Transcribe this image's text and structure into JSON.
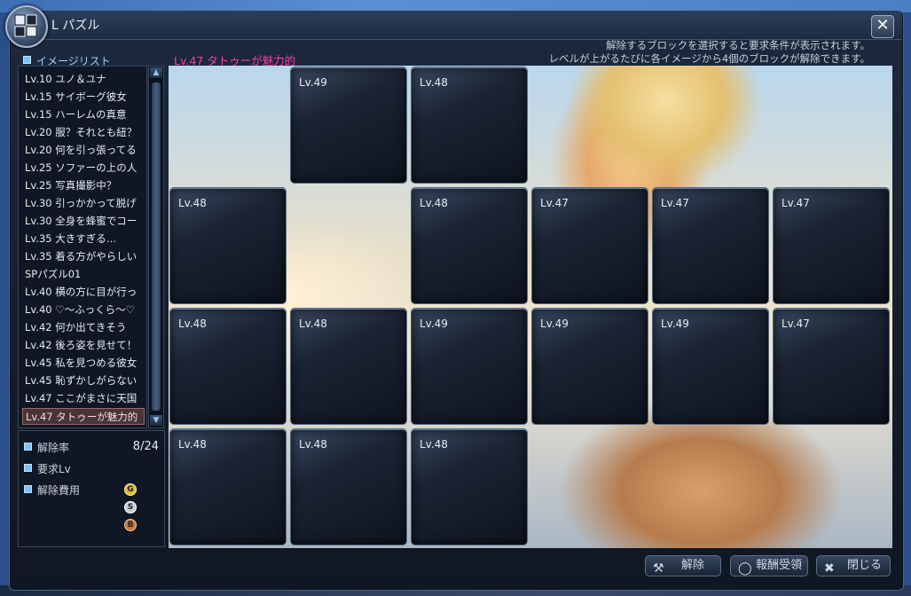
{
  "window": {
    "title": "L  パズル",
    "hint_line1": "解除するブロックを選択すると要求条件が表示されます。",
    "hint_line2": "レベルが上がるたびに各イメージから4個のブロックが解除できます。"
  },
  "sidebar": {
    "header": "イメージリスト",
    "items": [
      {
        "label": "Lv.10 ユノ＆ユナ"
      },
      {
        "label": "Lv.15 サイボーグ彼女"
      },
      {
        "label": "Lv.15 ハーレムの真意"
      },
      {
        "label": "Lv.20 服？それとも紐？"
      },
      {
        "label": "Lv.20 何を引っ張ってる"
      },
      {
        "label": "Lv.25 ソファーの上の人"
      },
      {
        "label": "Lv.25 写真撮影中？"
      },
      {
        "label": "Lv.30 引っかかって脱げ"
      },
      {
        "label": "Lv.30 全身を蜂蜜でコー"
      },
      {
        "label": "Lv.35 大きすぎる…"
      },
      {
        "label": "Lv.35 着る方がやらしい"
      },
      {
        "label": "SPパズル01"
      },
      {
        "label": "Lv.40 横の方に目が行っ"
      },
      {
        "label": "Lv.40 ♡～ふっくら～♡"
      },
      {
        "label": "Lv.42 何か出てきそう"
      },
      {
        "label": "Lv.42 後ろ姿を見せて！"
      },
      {
        "label": "Lv.45 私を見つめる彼女"
      },
      {
        "label": "Lv.45 恥ずかしがらない"
      },
      {
        "label": "Lv.47 ここがまさに天国"
      },
      {
        "label": "Lv.47 タトゥーが魅力的",
        "selected": true
      }
    ]
  },
  "info": {
    "unlock_rate_label": "解除率",
    "unlock_rate_value": "8/24",
    "required_lv_label": "要求Lv",
    "cost_label": "解除費用",
    "coin_g": "G",
    "coin_s": "S",
    "coin_b": "B"
  },
  "puzzle": {
    "image_title": "Lv.47 タトゥーが魅力的",
    "tiles": [
      {
        "row": 0,
        "col": 1,
        "label": "Lv.49"
      },
      {
        "row": 0,
        "col": 2,
        "label": "Lv.48"
      },
      {
        "row": 1,
        "col": 0,
        "label": "Lv.48"
      },
      {
        "row": 1,
        "col": 2,
        "label": "Lv.48"
      },
      {
        "row": 1,
        "col": 3,
        "label": "Lv.47"
      },
      {
        "row": 1,
        "col": 4,
        "label": "Lv.47"
      },
      {
        "row": 1,
        "col": 5,
        "label": "Lv.47"
      },
      {
        "row": 2,
        "col": 0,
        "label": "Lv.48"
      },
      {
        "row": 2,
        "col": 1,
        "label": "Lv.48"
      },
      {
        "row": 2,
        "col": 2,
        "label": "Lv.49"
      },
      {
        "row": 2,
        "col": 3,
        "label": "Lv.49"
      },
      {
        "row": 2,
        "col": 4,
        "label": "Lv.49"
      },
      {
        "row": 2,
        "col": 5,
        "label": "Lv.47"
      },
      {
        "row": 3,
        "col": 0,
        "label": "Lv.48"
      },
      {
        "row": 3,
        "col": 1,
        "label": "Lv.48"
      },
      {
        "row": 3,
        "col": 2,
        "label": "Lv.48"
      }
    ]
  },
  "footer": {
    "unlock_label": "解除",
    "reward_label": "報酬受領",
    "close_label": "閉じる"
  },
  "colors": {
    "accent_title": "#ff3aa7",
    "selected_bg": "#4a3436"
  }
}
